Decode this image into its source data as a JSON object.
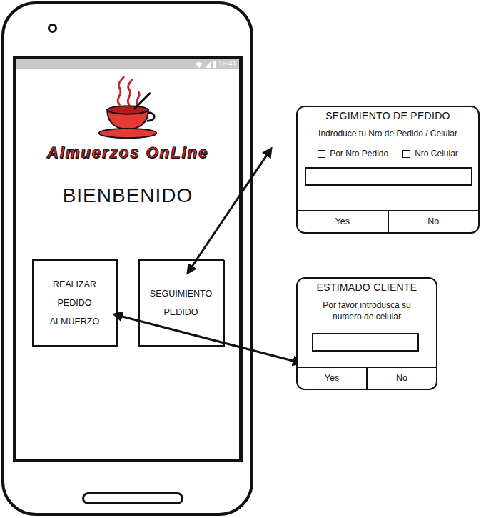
{
  "phone": {
    "status_time": "16:41",
    "logo_text": "Almuerzos OnLine",
    "welcome": "BIENBENIDO",
    "buttons": [
      {
        "lines": [
          "REALIZAR",
          "PEDIDO",
          "ALMUERZO"
        ]
      },
      {
        "lines": [
          "SEGUIMIENTO",
          "PEDIDO"
        ]
      }
    ]
  },
  "dialogs": [
    {
      "title": "SEGIMIENTO DE PEDIDO",
      "prompt_lines": [
        "Indroduce tu Nro de Pedido / Celular"
      ],
      "options": [
        {
          "label": "Por Nro Pedido",
          "checked": false
        },
        {
          "label": "Nro Celular",
          "checked": false
        }
      ],
      "buttons": [
        "Yes",
        "No"
      ]
    },
    {
      "title": "ESTIMADO CLIENTE",
      "prompt_lines": [
        "Por favor introdusca su",
        "numero de celular"
      ],
      "options": [],
      "buttons": [
        "Yes",
        "No"
      ]
    }
  ]
}
